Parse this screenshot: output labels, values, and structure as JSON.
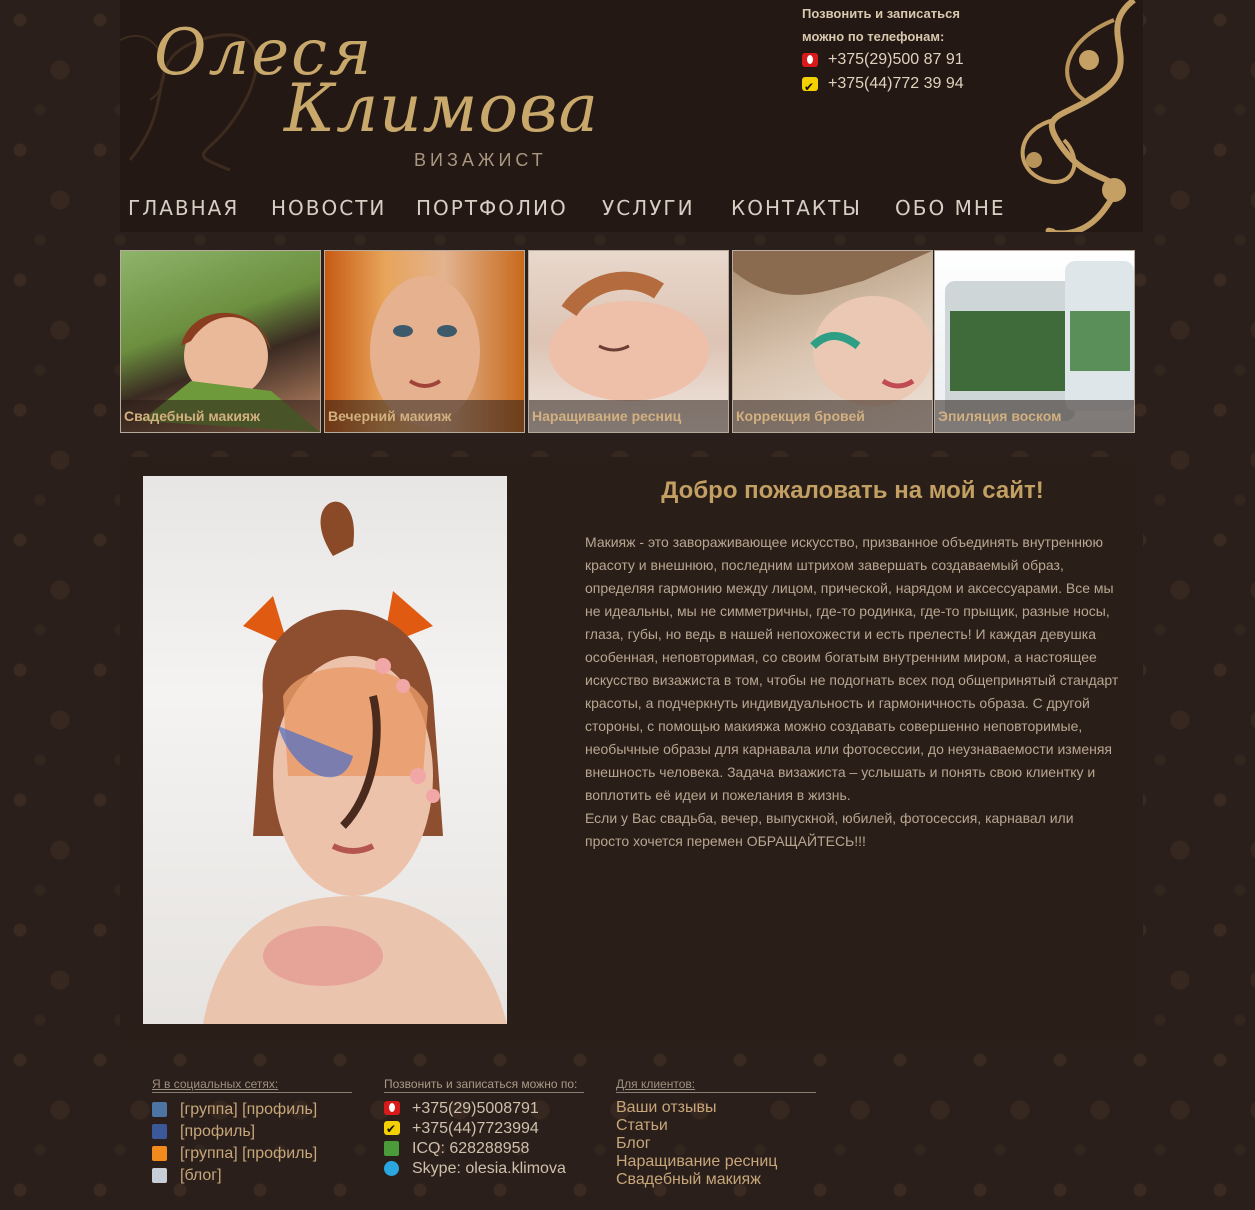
{
  "header": {
    "logo_name_first": "Олеся",
    "logo_name_last": "Климова",
    "logo_subtitle": "ВИЗАЖИСТ",
    "call_title_line1": "Позвонить и записаться",
    "call_title_line2": "можно по телефонам:",
    "phones": [
      "+375(29)500 87 91",
      "+375(44)772 39 94"
    ]
  },
  "nav": [
    "ГЛАВНАЯ",
    "НОВОСТИ",
    "ПОРТФОЛИО",
    "УСЛУГИ",
    "КОНТАКТЫ",
    "ОБО МНЕ"
  ],
  "tiles": [
    {
      "label": "Свадебный макияж"
    },
    {
      "label": "Вечерний макияж"
    },
    {
      "label": "Наращивание ресниц"
    },
    {
      "label": "Коррекция бровей"
    },
    {
      "label": "Эпиляция воском"
    }
  ],
  "main": {
    "title": "Добро пожаловать на мой сайт!",
    "paragraph1": "Макияж - это завораживающее искусство, призванное объединять внутреннюю красоту и внешнюю, последним штрихом завершать создаваемый образ, определяя гармонию между лицом, прической, нарядом и аксессуарами. Все мы не идеальны, мы не симметричны, где-то родинка, где-то прыщик, разные носы, глаза, губы, но ведь в нашей непохожести и есть прелесть! И каждая девушка особенная, неповторимая, со своим богатым внутренним миром, а настоящее искусство визажиста в том, чтобы не подогнать всех под общепринятый стандарт красоты, а подчеркнуть индивидуальность и гармоничность образа. С другой стороны, с помощью макияжа можно создавать совершенно неповторимые, необычные образы для карнавала или фотосессии, до неузнаваемости изменяя внешность человека. Задача визажиста – услышать и понять свою клиентку и воплотить её идеи и пожелания в жизнь.",
    "paragraph2": "Если у Вас свадьба, вечер, выпускной, юбилей, фотосессия, карнавал или просто хочется перемен ОБРАЩАЙТЕСЬ!!!"
  },
  "footer": {
    "social_title": "Я в социальных сетях:",
    "social": [
      {
        "icon": "vkontakte-icon",
        "links": [
          "[группа]",
          "[профиль]"
        ]
      },
      {
        "icon": "facebook-icon",
        "links": [
          "[профиль]"
        ]
      },
      {
        "icon": "odnoklassniki-icon",
        "links": [
          "[группа]",
          "[профиль]"
        ]
      },
      {
        "icon": "livejournal-icon",
        "links": [
          "[блог]"
        ]
      }
    ],
    "contact_title": "Позвонить и записаться можно по:",
    "contacts": [
      {
        "icon": "mts-icon",
        "text": "+375(29)5008791"
      },
      {
        "icon": "velcom-icon",
        "text": "+375(44)7723994"
      },
      {
        "icon": "icq-icon",
        "text": "ICQ: 628288958"
      },
      {
        "icon": "skype-icon",
        "text": "Skype: olesia.klimova"
      }
    ],
    "clients_title": "Для клиентов:",
    "clients_links": [
      "Ваши отзывы",
      "Статьи",
      "Блог",
      "Наращивание ресниц",
      "Свадебный макияж"
    ]
  }
}
